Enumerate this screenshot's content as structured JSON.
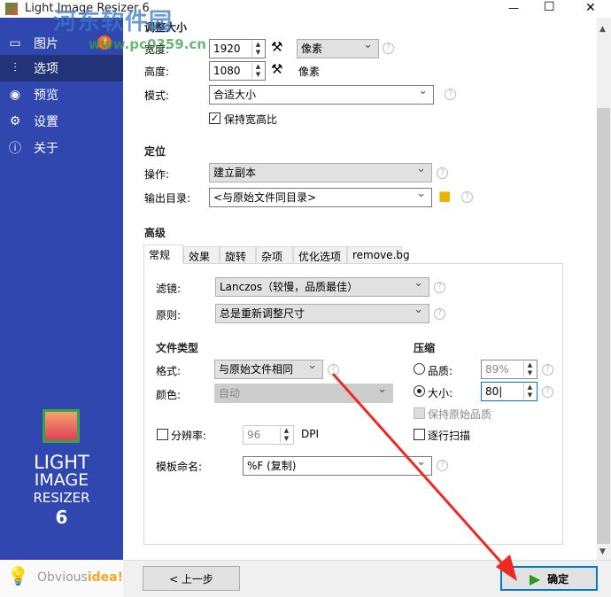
{
  "window": {
    "title": "Light Image Resizer 6",
    "minimize": "—",
    "maximize": "☐",
    "close": "✕"
  },
  "watermark": {
    "name": "河东软件园",
    "url": "www.pc0359.cn"
  },
  "sidebar": {
    "items": [
      {
        "label": "图片",
        "icon": "image-icon",
        "badge": "3"
      },
      {
        "label": "选项",
        "icon": "sliders-icon"
      },
      {
        "label": "预览",
        "icon": "eye-icon"
      },
      {
        "label": "设置",
        "icon": "gear-icon"
      },
      {
        "label": "关于",
        "icon": "info-icon"
      }
    ],
    "logo": {
      "line1": "LIGHT",
      "line2": "IMAGE",
      "line3": "RESIZER",
      "line4": "6"
    },
    "brand": {
      "a": "Obvious",
      "b": "idea!"
    }
  },
  "resize": {
    "title": "调整大小",
    "width_label": "宽度:",
    "width": "1920",
    "height_label": "高度:",
    "height": "1080",
    "unit": "像素",
    "height_unit": "像素",
    "mode_label": "模式:",
    "mode": "合适大小",
    "keep_ratio": "保持宽高比",
    "keep_ratio_checked": true
  },
  "position": {
    "title": "定位",
    "action_label": "操作:",
    "action": "建立副本",
    "output_label": "输出目录:",
    "output": "<与原始文件同目录>"
  },
  "advanced": {
    "title": "高级",
    "tabs": [
      "常规",
      "效果",
      "旋转",
      "杂项",
      "优化选项",
      "remove.bg"
    ],
    "filter_label": "滤镜:",
    "filter": "Lanczos（较慢，品质最佳）",
    "rule_label": "原则:",
    "rule": "总是重新调整尺寸",
    "filetype_title": "文件类型",
    "format_label": "格式:",
    "format": "与原始文件相同",
    "color_label": "颜色:",
    "color": "自动",
    "resolution_label": "分辨率:",
    "resolution": "96",
    "dpi": "DPI",
    "template_label": "模板命名:",
    "template": "%F (复制)",
    "compress_title": "压缩",
    "quality_label": "品质:",
    "quality": "89%",
    "size_label": "大小:",
    "size": "80",
    "keep_quality": "保持原始品质",
    "progressive": "逐行扫描"
  },
  "footer": {
    "back": "< 上一步",
    "ok": "确定"
  }
}
